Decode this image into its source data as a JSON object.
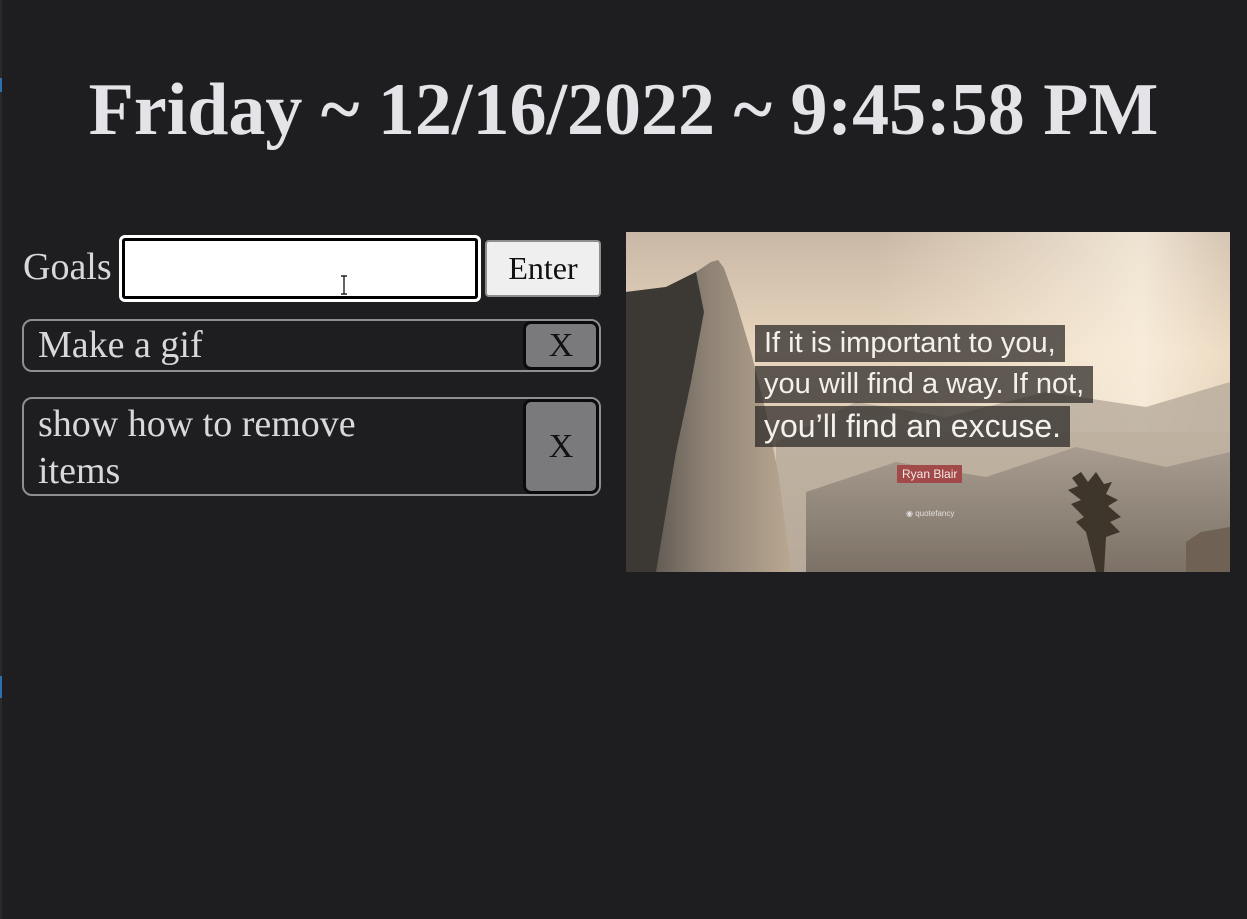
{
  "header": {
    "datetime": "Friday ~ 12/16/2022 ~ 9:45:58 PM"
  },
  "goals": {
    "label": "Goals",
    "input_value": "",
    "enter_label": "Enter",
    "items": [
      {
        "text": "Make a gif",
        "remove_label": "X"
      },
      {
        "text": "show how to remove items",
        "remove_label": "X"
      }
    ]
  },
  "quote": {
    "lines": [
      "If it is important to you,",
      "you will find a way. If not,",
      "you’ll find an excuse."
    ],
    "author": "Ryan Blair",
    "watermark": "quotefancy"
  },
  "colors": {
    "background": "#1e1e20",
    "text": "#e4e3e8",
    "author_badge": "#a24a4a"
  },
  "icons": {
    "cursor": "text-cursor-icon"
  }
}
